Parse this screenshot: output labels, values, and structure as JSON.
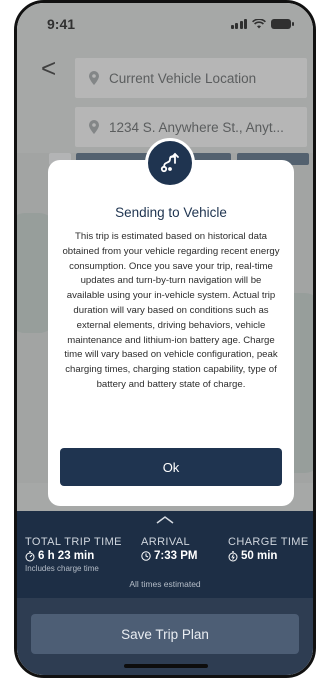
{
  "status_bar": {
    "time": "9:41"
  },
  "nav": {
    "back_glyph": "<"
  },
  "route": {
    "origin": "Current Vehicle Location",
    "destination": "1234 S. Anywhere St., Anyt..."
  },
  "modal": {
    "icon": "route-send-icon",
    "title": "Sending to Vehicle",
    "body": "This trip is estimated based on historical data obtained from your vehicle regarding recent energy consumption. Once you save your trip, real-time updates and turn-by-turn navigation will be available using your in-vehicle system. Actual trip duration will vary based on conditions such as external elements, driving behaviors, vehicle maintenance and lithium-ion battery age. Charge time will vary based on vehicle configuration, peak charging times, charging station capability, type of battery and battery state of charge.",
    "ok_label": "Ok"
  },
  "summary": {
    "total_label": "TOTAL TRIP TIME",
    "total_value": "6 h 23 min",
    "total_note": "Includes charge time",
    "arrival_label": "ARRIVAL",
    "arrival_value": "7:33 PM",
    "charge_label": "CHARGE TIME",
    "charge_value": "50 min",
    "estimated_note": "All times estimated"
  },
  "actions": {
    "save_label": "Save Trip Plan"
  },
  "colors": {
    "navy": "#1f3450",
    "summary_bg": "#1d2e45",
    "save_button": "#4d5e75"
  }
}
